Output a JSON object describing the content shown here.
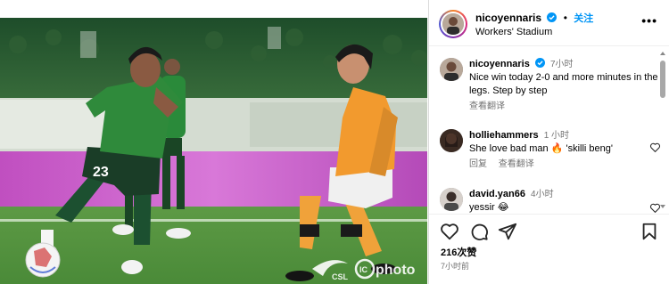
{
  "post": {
    "author": "nicoyennaris",
    "separator": "•",
    "follow_label": "关注",
    "location": "Workers' Stadium",
    "more_label": "•••",
    "likes": "216次赞",
    "posted_ago": "7小时前"
  },
  "photo": {
    "jersey_number": "23",
    "watermark_csl": "CSL",
    "watermark_photo": "photo",
    "watermark_ic": "IC"
  },
  "comments": [
    {
      "user": "nicoyennaris",
      "verified": true,
      "time": "7小时",
      "text": "Nice win today 2-0 and more minutes in the legs. Step by step",
      "actions": [
        "查看翻译"
      ]
    },
    {
      "user": "holliehammers",
      "verified": false,
      "time": "1 小时",
      "text": "She love bad man 🔥 'skilli beng'",
      "actions": [
        "回复",
        "查看翻译"
      ]
    },
    {
      "user": "david.yan66",
      "verified": false,
      "time": "4小时",
      "text": "yessir 😂",
      "actions": []
    }
  ],
  "colors": {
    "accent": "#0095f6",
    "secondary_text": "#737373",
    "verified": "#0095f6"
  },
  "icons": [
    "heart-icon",
    "comment-icon",
    "share-icon",
    "bookmark-icon",
    "verified-badge-icon",
    "more-icon"
  ]
}
